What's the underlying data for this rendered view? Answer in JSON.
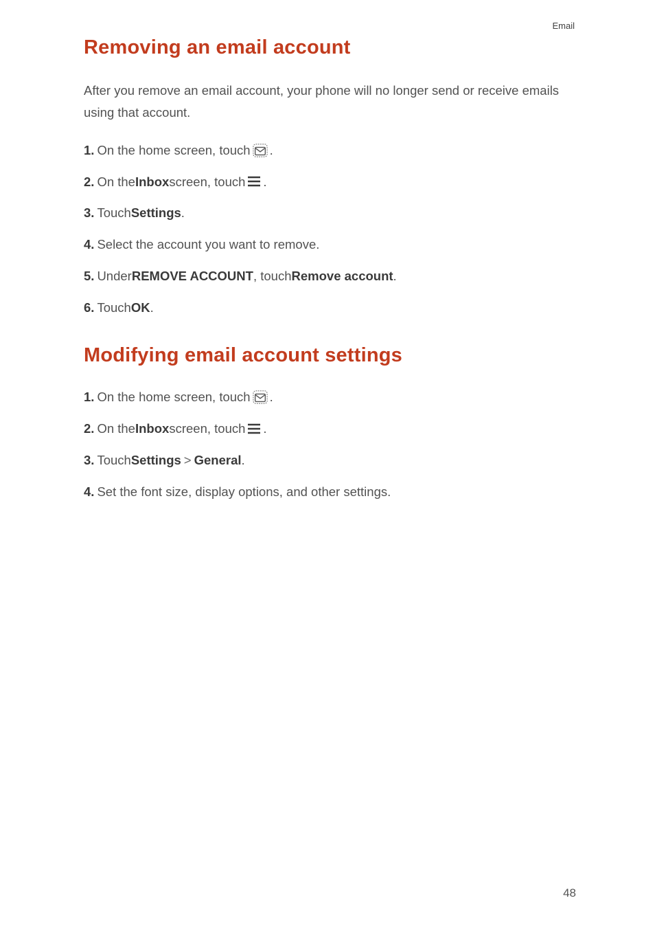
{
  "header": {
    "category": "Email"
  },
  "section1": {
    "title": "Removing an email account",
    "intro": "After you remove an email account, your phone will no longer send or receive emails using that account.",
    "steps": {
      "s1": {
        "num": "1.",
        "pre": "On the home screen, touch ",
        "post": "."
      },
      "s2": {
        "num": "2.",
        "pre": "On the ",
        "bold1": "Inbox",
        "mid": " screen, touch ",
        "post": "."
      },
      "s3": {
        "num": "3.",
        "pre": "Touch ",
        "bold1": "Settings",
        "post": "."
      },
      "s4": {
        "num": "4.",
        "text": "Select the account you want to remove."
      },
      "s5": {
        "num": "5.",
        "pre": "Under ",
        "bold1": "REMOVE ACCOUNT",
        "mid": ", touch ",
        "bold2": "Remove account",
        "post": "."
      },
      "s6": {
        "num": "6.",
        "pre": "Touch ",
        "bold1": "OK",
        "post": "."
      }
    }
  },
  "section2": {
    "title": "Modifying email account settings",
    "steps": {
      "s1": {
        "num": "1.",
        "pre": "On the home screen, touch ",
        "post": "."
      },
      "s2": {
        "num": "2.",
        "pre": "On the ",
        "bold1": "Inbox",
        "mid": " screen, touch ",
        "post": "."
      },
      "s3": {
        "num": "3.",
        "pre": "Touch ",
        "bold1": "Settings",
        "gt": ">",
        "bold2": "General",
        "post": "."
      },
      "s4": {
        "num": "4.",
        "text": "Set the font size, display options, and other settings."
      }
    }
  },
  "pageNumber": "48"
}
